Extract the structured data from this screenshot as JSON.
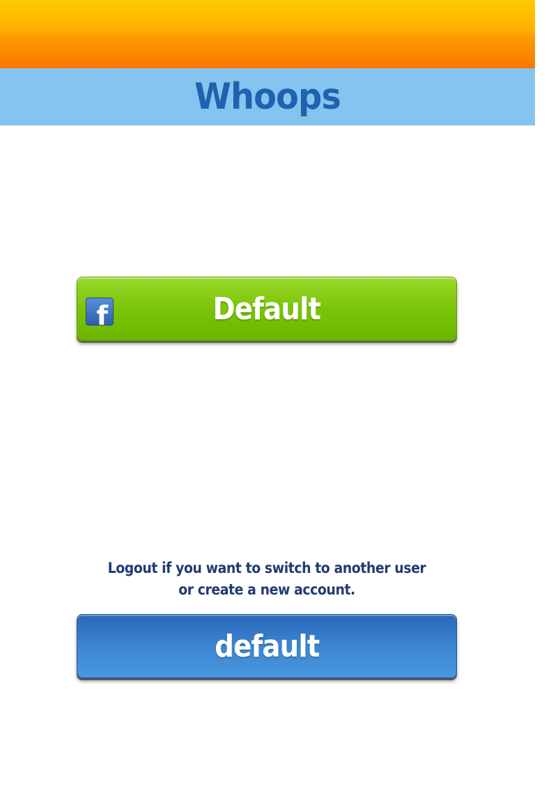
{
  "header": {
    "title": "Whoops"
  },
  "facebook_button": {
    "label": "Default",
    "icon": "facebook-icon",
    "icon_glyph": "f",
    "color": "#7cc60a"
  },
  "logout_section": {
    "message_line1": "Logout if you want to switch to another user",
    "message_line2": "or create a new account.",
    "button_label": "default",
    "button_color": "#3b86d2"
  },
  "colors": {
    "top_bar": "#ff9a00",
    "title_band": "#85c4ee",
    "title_text": "#1f62b0",
    "message_text": "#233b72"
  }
}
